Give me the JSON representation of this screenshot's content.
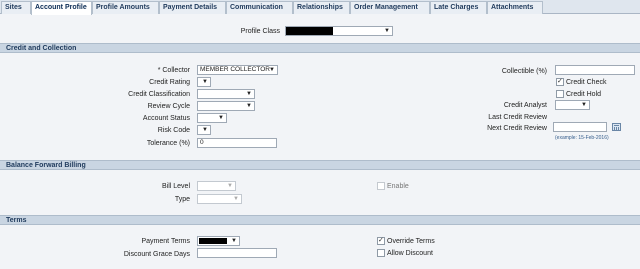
{
  "tabs": [
    {
      "label": "Sites"
    },
    {
      "label": "Account Profile",
      "active": true
    },
    {
      "label": "Profile Amounts"
    },
    {
      "label": "Payment Details"
    },
    {
      "label": "Communication"
    },
    {
      "label": "Relationships"
    },
    {
      "label": "Order Management"
    },
    {
      "label": "Late Charges"
    },
    {
      "label": "Attachments"
    }
  ],
  "profile_class": {
    "label": "Profile Class"
  },
  "credit_collection": {
    "section_title": "Credit and Collection",
    "collector": {
      "label": "* Collector",
      "value": "MEMBER COLLECTOR"
    },
    "credit_rating": {
      "label": "Credit Rating"
    },
    "credit_classification": {
      "label": "Credit Classification"
    },
    "review_cycle": {
      "label": "Review Cycle"
    },
    "account_status": {
      "label": "Account Status"
    },
    "risk_code": {
      "label": "Risk Code"
    },
    "tolerance": {
      "label": "Tolerance (%)",
      "value": "0"
    },
    "collectible": {
      "label": "Collectible (%)"
    },
    "credit_check": {
      "label": "Credit Check",
      "checked": true
    },
    "credit_hold": {
      "label": "Credit Hold",
      "checked": false
    },
    "credit_analyst": {
      "label": "Credit Analyst"
    },
    "last_credit_review": {
      "label": "Last Credit Review"
    },
    "next_credit_review": {
      "label": "Next Credit Review",
      "hint": "(example: 15-Feb-2016)"
    }
  },
  "balance_forward": {
    "section_title": "Balance Forward Billing",
    "bill_level": {
      "label": "Bill Level"
    },
    "type": {
      "label": "Type"
    },
    "enable": {
      "label": "Enable",
      "checked": false
    }
  },
  "terms": {
    "section_title": "Terms",
    "payment_terms": {
      "label": "Payment Terms"
    },
    "discount_grace_days": {
      "label": "Discount Grace Days"
    },
    "override_terms": {
      "label": "Override Terms",
      "checked": true
    },
    "allow_discount": {
      "label": "Allow Discount",
      "checked": false
    }
  }
}
